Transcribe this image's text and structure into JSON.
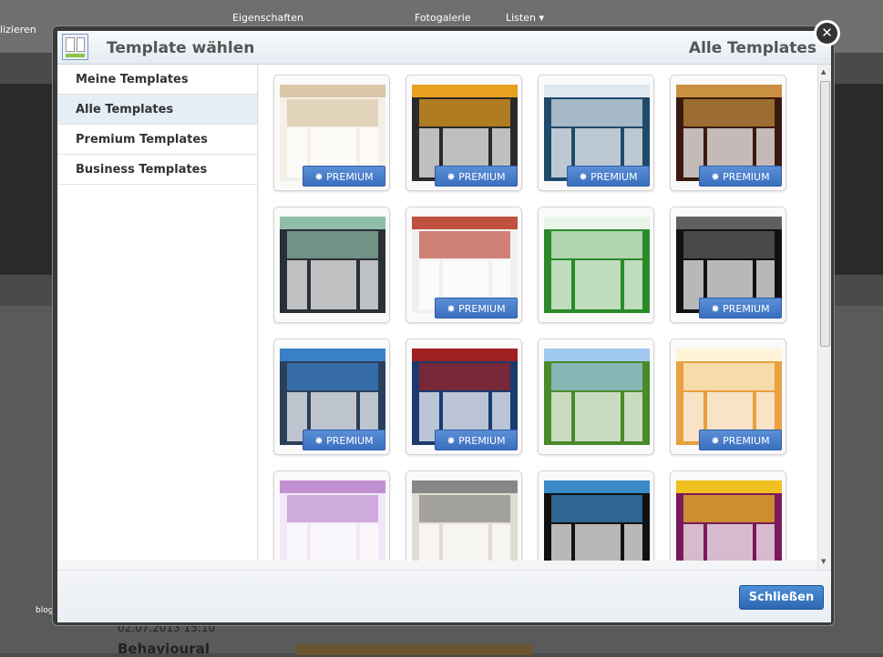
{
  "background": {
    "toolbar_items": [
      "lizieren",
      "Eigenschaften",
      "Fotogalerie",
      "Listen ▾"
    ],
    "blog": "blog",
    "date": "02.07.2013 15:10",
    "heading": "Behavioural"
  },
  "modal": {
    "title": "Template wählen",
    "subtitle": "Alle Templates",
    "close_label": "Schließen"
  },
  "sidebar": {
    "items": [
      {
        "label": "Meine Templates",
        "active": false
      },
      {
        "label": "Alle Templates",
        "active": true
      },
      {
        "label": "Premium Templates",
        "active": false
      },
      {
        "label": "Business Templates",
        "active": false
      }
    ]
  },
  "premium_label": "PREMIUM",
  "templates": [
    {
      "premium": true,
      "colors": [
        "#f4f0e8",
        "#d9c7a8"
      ]
    },
    {
      "premium": true,
      "colors": [
        "#2a2a2a",
        "#e8a020"
      ]
    },
    {
      "premium": true,
      "colors": [
        "#1f4a6a",
        "#dfe8ef"
      ]
    },
    {
      "premium": true,
      "colors": [
        "#3a1a10",
        "#c89040"
      ]
    },
    {
      "premium": false,
      "colors": [
        "#2a2e35",
        "#8fbfa8"
      ]
    },
    {
      "premium": true,
      "colors": [
        "#f0f0f0",
        "#c05040"
      ]
    },
    {
      "premium": false,
      "colors": [
        "#2a8a2a",
        "#e8f4e8"
      ]
    },
    {
      "premium": true,
      "colors": [
        "#111111",
        "#606060"
      ]
    },
    {
      "premium": true,
      "colors": [
        "#2a3f5a",
        "#3a80c8"
      ]
    },
    {
      "premium": true,
      "colors": [
        "#1a3a70",
        "#a02020"
      ]
    },
    {
      "premium": false,
      "colors": [
        "#4a8a2a",
        "#a0c8f0"
      ]
    },
    {
      "premium": true,
      "colors": [
        "#e8a040",
        "#fff4d8"
      ]
    },
    {
      "premium": true,
      "colors": [
        "#f0e8f8",
        "#c090d0"
      ]
    },
    {
      "premium": true,
      "colors": [
        "#e0dcd4",
        "#888888"
      ]
    },
    {
      "premium": true,
      "colors": [
        "#111111",
        "#3a8ac8"
      ]
    },
    {
      "premium": false,
      "colors": [
        "#7a1a5a",
        "#f0c020"
      ]
    }
  ]
}
